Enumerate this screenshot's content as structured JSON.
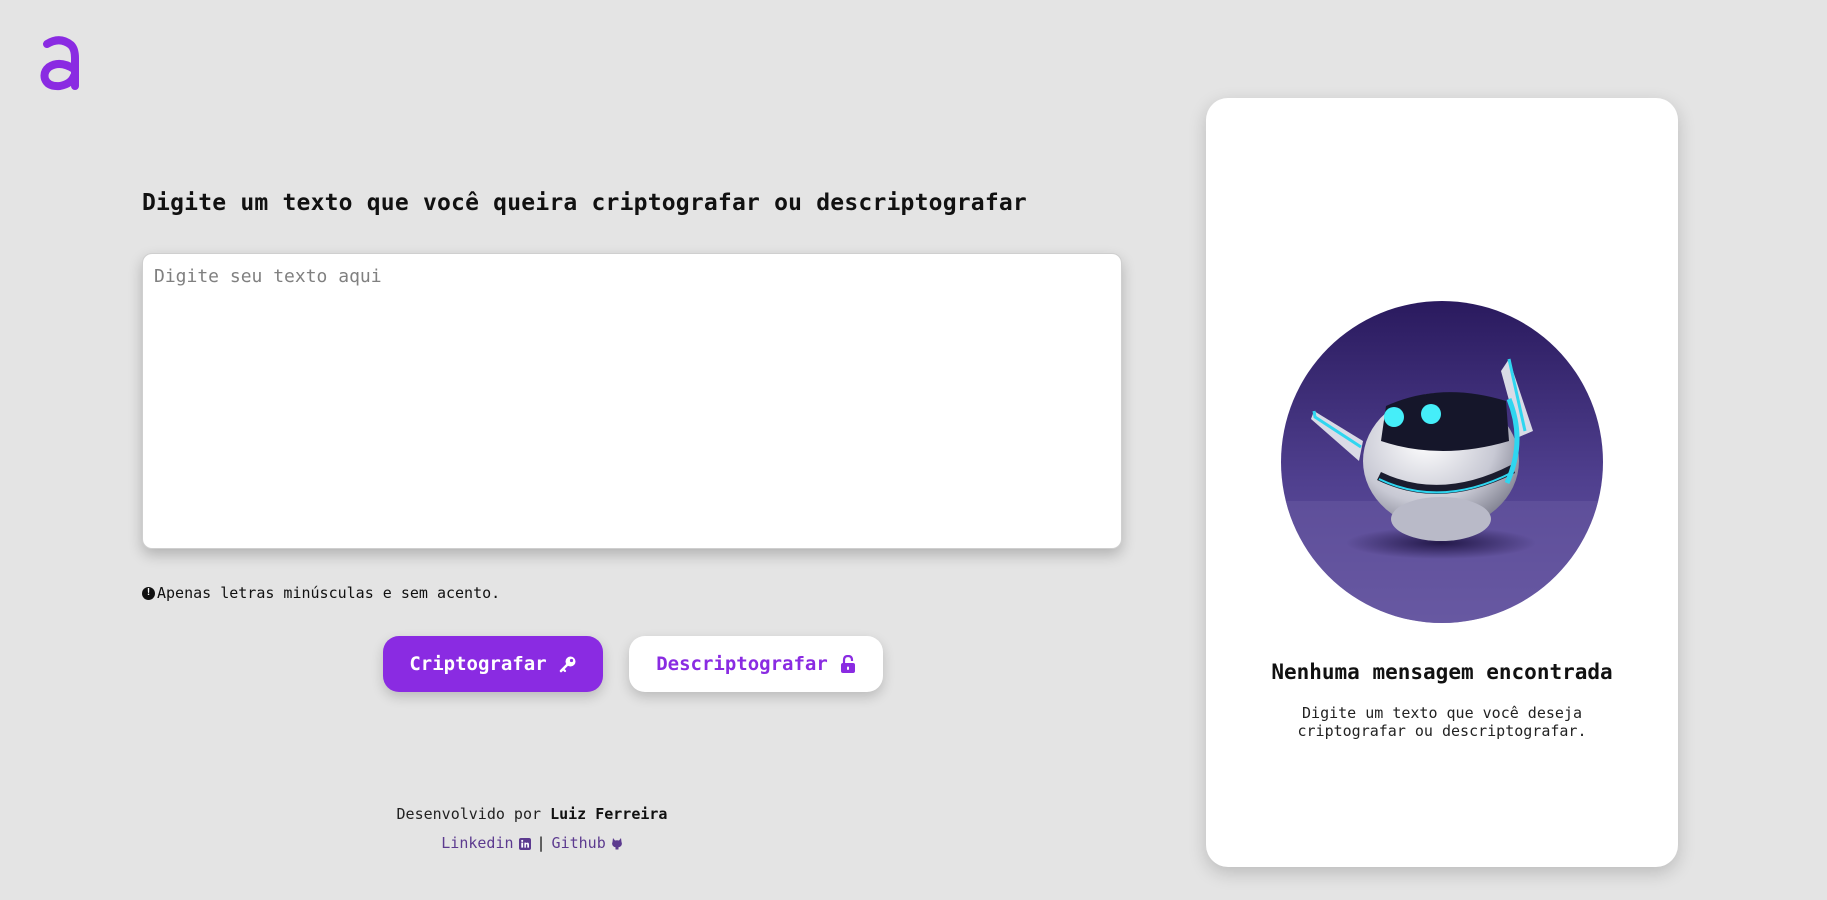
{
  "logo": {
    "letter": "a",
    "color": "#8a2be2"
  },
  "main": {
    "heading": "Digite um texto que você queira criptografar ou descriptografar",
    "input": {
      "placeholder": "Digite seu texto aqui",
      "value": ""
    },
    "hint": {
      "icon": "info-icon",
      "text": "Apenas letras minúsculas e sem acento."
    },
    "buttons": {
      "encrypt": {
        "label": "Criptografar",
        "icon": "key-icon"
      },
      "decrypt": {
        "label": "Descriptografar",
        "icon": "unlock-icon"
      }
    }
  },
  "footer": {
    "developed_by": "Desenvolvido por",
    "author": "Luiz Ferreira",
    "linkedin": {
      "label": "Linkedin",
      "icon": "linkedin-icon"
    },
    "separator": "|",
    "github": {
      "label": "Github",
      "icon": "github-icon"
    }
  },
  "result_panel": {
    "image": "robot-illustration",
    "title": "Nenhuma mensagem encontrada",
    "text": "Digite um texto que você deseja criptografar ou descriptografar."
  },
  "colors": {
    "accent": "#8a2be2",
    "background": "#e4e4e4",
    "card": "#ffffff",
    "link": "#5c3a8f"
  }
}
